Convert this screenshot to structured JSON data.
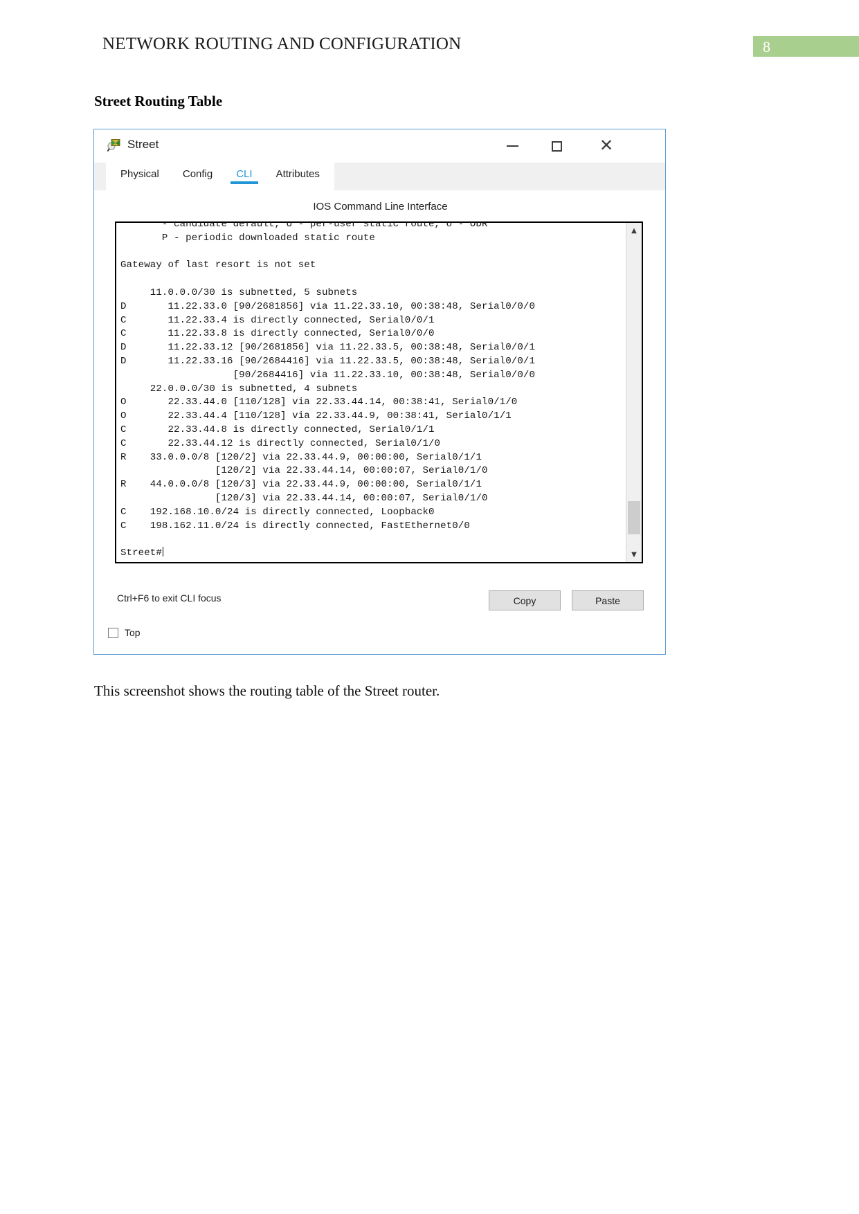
{
  "document": {
    "header_title": "NETWORK ROUTING AND CONFIGURATION",
    "page_number": "8",
    "page_badge_color": "#a9cf8f",
    "section_heading": "Street Routing Table",
    "caption": "This screenshot shows the routing table of the Street router."
  },
  "window": {
    "title": "Street",
    "icon": "packet-tracer-device-icon",
    "accent_color": "#2196d6",
    "controls": {
      "minimize": "—",
      "maximize": "□",
      "close": "✕"
    },
    "tabs": [
      {
        "label": "Physical",
        "active": false
      },
      {
        "label": "Config",
        "active": false
      },
      {
        "label": "CLI",
        "active": true
      },
      {
        "label": "Attributes",
        "active": false
      }
    ],
    "panel": {
      "title": "IOS Command Line Interface",
      "terminal_text": "     * - candidate default, U - per-user static route, o - ODR\n       P - periodic downloaded static route\n\nGateway of last resort is not set\n\n     11.0.0.0/30 is subnetted, 5 subnets\nD       11.22.33.0 [90/2681856] via 11.22.33.10, 00:38:48, Serial0/0/0\nC       11.22.33.4 is directly connected, Serial0/0/1\nC       11.22.33.8 is directly connected, Serial0/0/0\nD       11.22.33.12 [90/2681856] via 11.22.33.5, 00:38:48, Serial0/0/1\nD       11.22.33.16 [90/2684416] via 11.22.33.5, 00:38:48, Serial0/0/1\n                   [90/2684416] via 11.22.33.10, 00:38:48, Serial0/0/0\n     22.0.0.0/30 is subnetted, 4 subnets\nO       22.33.44.0 [110/128] via 22.33.44.14, 00:38:41, Serial0/1/0\nO       22.33.44.4 [110/128] via 22.33.44.9, 00:38:41, Serial0/1/1\nC       22.33.44.8 is directly connected, Serial0/1/1\nC       22.33.44.12 is directly connected, Serial0/1/0\nR    33.0.0.0/8 [120/2] via 22.33.44.9, 00:00:00, Serial0/1/1\n                [120/2] via 22.33.44.14, 00:00:07, Serial0/1/0\nR    44.0.0.0/8 [120/3] via 22.33.44.9, 00:00:00, Serial0/1/1\n                [120/3] via 22.33.44.14, 00:00:07, Serial0/1/0\nC    192.168.10.0/24 is directly connected, Loopback0\nC    198.162.11.0/24 is directly connected, FastEthernet0/0\n\nStreet#",
      "prompt": "Street#",
      "cli_hint": "Ctrl+F6 to exit CLI focus",
      "copy_label": "Copy",
      "paste_label": "Paste",
      "scroll_up_glyph": "▲",
      "scroll_down_glyph": "▼"
    },
    "footer": {
      "top_checkbox_label": "Top",
      "top_checkbox_checked": false
    }
  }
}
